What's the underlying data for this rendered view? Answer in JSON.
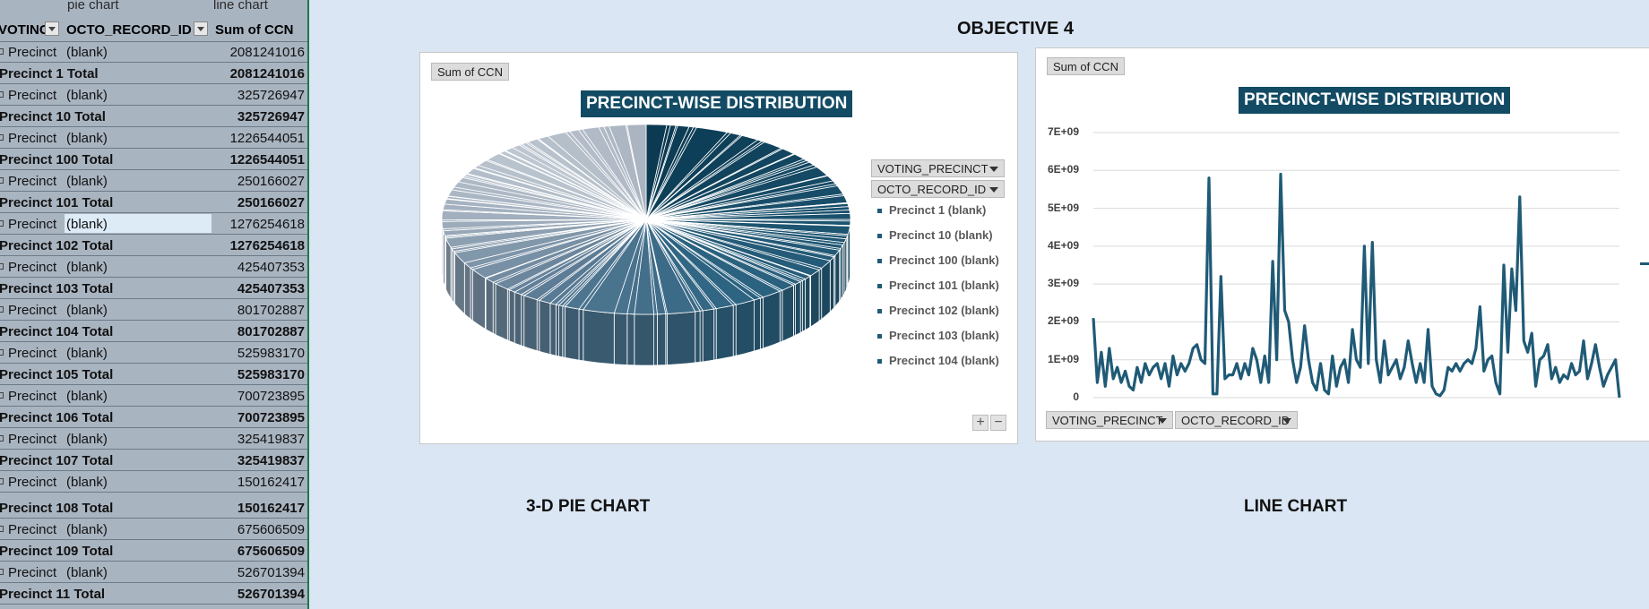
{
  "pivot": {
    "top_labels": [
      "pie chart",
      "line chart"
    ],
    "headers": [
      "VOTING",
      "OCTO_RECORD_ID",
      "Sum of CCN"
    ],
    "rows": [
      {
        "label": "Precinct",
        "sub": "(blank)",
        "value": "2081241016",
        "total": false
      },
      {
        "label": "Precinct 1 Total",
        "sub": "",
        "value": "2081241016",
        "total": true
      },
      {
        "label": "Precinct",
        "sub": "(blank)",
        "value": "325726947",
        "total": false
      },
      {
        "label": "Precinct 10 Total",
        "sub": "",
        "value": "325726947",
        "total": true
      },
      {
        "label": "Precinct",
        "sub": "(blank)",
        "value": "1226544051",
        "total": false
      },
      {
        "label": "Precinct 100 Total",
        "sub": "",
        "value": "1226544051",
        "total": true
      },
      {
        "label": "Precinct",
        "sub": "(blank)",
        "value": "250166027",
        "total": false
      },
      {
        "label": "Precinct 101 Total",
        "sub": "",
        "value": "250166027",
        "total": true
      },
      {
        "label": "Precinct",
        "sub": "(blank)",
        "value": "1276254618",
        "total": false,
        "selected": true
      },
      {
        "label": "Precinct 102 Total",
        "sub": "",
        "value": "1276254618",
        "total": true
      },
      {
        "label": "Precinct",
        "sub": "(blank)",
        "value": "425407353",
        "total": false
      },
      {
        "label": "Precinct 103 Total",
        "sub": "",
        "value": "425407353",
        "total": true
      },
      {
        "label": "Precinct",
        "sub": "(blank)",
        "value": "801702887",
        "total": false
      },
      {
        "label": "Precinct 104 Total",
        "sub": "",
        "value": "801702887",
        "total": true
      },
      {
        "label": "Precinct",
        "sub": "(blank)",
        "value": "525983170",
        "total": false
      },
      {
        "label": "Precinct 105 Total",
        "sub": "",
        "value": "525983170",
        "total": true
      },
      {
        "label": "Precinct",
        "sub": "(blank)",
        "value": "700723895",
        "total": false
      },
      {
        "label": "Precinct 106 Total",
        "sub": "",
        "value": "700723895",
        "total": true
      },
      {
        "label": "Precinct",
        "sub": "(blank)",
        "value": "325419837",
        "total": false
      },
      {
        "label": "Precinct 107 Total",
        "sub": "",
        "value": "325419837",
        "total": true
      },
      {
        "label": "Precinct",
        "sub": "(blank)",
        "value": "150162417",
        "total": false
      },
      {
        "label": "Precinct 108 Total",
        "sub": "",
        "value": "150162417",
        "total": true
      },
      {
        "label": "Precinct",
        "sub": "(blank)",
        "value": "675606509",
        "total": false
      },
      {
        "label": "Precinct 109 Total",
        "sub": "",
        "value": "675606509",
        "total": true
      },
      {
        "label": "Precinct",
        "sub": "(blank)",
        "value": "526701394",
        "total": false
      },
      {
        "label": "Precinct 11 Total",
        "sub": "",
        "value": "526701394",
        "total": true
      }
    ]
  },
  "titles": {
    "objective": "OBJECTIVE 4",
    "pie_caption": "3-D PIE CHART",
    "line_caption": "LINE CHART"
  },
  "pie_panel": {
    "value_button": "Sum of CCN",
    "legend_fields": [
      "VOTING_PRECINCT",
      "OCTO_RECORD_ID"
    ],
    "legend_items": [
      "Precinct 1 (blank)",
      "Precinct 10 (blank)",
      "Precinct 100 (blank)",
      "Precinct 101 (blank)",
      "Precinct 102 (blank)",
      "Precinct 103 (blank)",
      "Precinct 104 (blank)"
    ],
    "zoom_plus": "+",
    "zoom_minus": "−"
  },
  "line_panel": {
    "value_button": "Sum of CCN",
    "axis_fields": [
      "VOTING_PRECINCT",
      "OCTO_RECORD_ID"
    ]
  },
  "chart_data": [
    {
      "type": "pie",
      "title": "PRECINCT-WISE DISTRIBUTION",
      "three_d": true,
      "legend_position": "right",
      "series_colors": [
        "#0b3a52",
        "#1f5a76",
        "#3d6e8a",
        "#6a8aa3",
        "#a9b6c3",
        "#c9d1da"
      ],
      "categories": [
        "Precinct 1 (blank)",
        "Precinct 10 (blank)",
        "Precinct 100 (blank)",
        "Precinct 101 (blank)",
        "Precinct 102 (blank)",
        "Precinct 103 (blank)",
        "Precinct 104 (blank)"
      ],
      "values": [
        2081241016,
        325726947,
        1226544051,
        250166027,
        1276254618,
        425407353,
        801702887
      ]
    },
    {
      "type": "line",
      "title": "PRECINCT-WISE DISTRIBUTION",
      "color": "#1f5a76",
      "ylim": [
        0,
        7000000000
      ],
      "ytick_labels": [
        "0",
        "1E+09",
        "2E+09",
        "3E+09",
        "4E+09",
        "5E+09",
        "6E+09",
        "7E+09"
      ],
      "grid": true,
      "values": [
        2100000000.0,
        400000000.0,
        1200000000.0,
        300000000.0,
        1300000000.0,
        500000000.0,
        800000000.0,
        400000000.0,
        700000000.0,
        300000000.0,
        200000000.0,
        800000000.0,
        400000000.0,
        900000000.0,
        600000000.0,
        800000000.0,
        900000000.0,
        500000000.0,
        900000000.0,
        300000000.0,
        1100000000.0,
        600000000.0,
        900000000.0,
        700000000.0,
        900000000.0,
        1300000000.0,
        1400000000.0,
        1000000000.0,
        900000000.0,
        5800000000.0,
        100000000.0,
        100000000.0,
        3200000000.0,
        500000000.0,
        600000000.0,
        600000000.0,
        900000000.0,
        500000000.0,
        900000000.0,
        600000000.0,
        1300000000.0,
        1000000000.0,
        400000000.0,
        1100000000.0,
        400000000.0,
        3600000000.0,
        1000000000.0,
        5900000000.0,
        2300000000.0,
        2000000000.0,
        1000000000.0,
        400000000.0,
        800000000.0,
        1900000000.0,
        1000000000.0,
        400000000.0,
        200000000.0,
        900000000.0,
        200000000.0,
        100000000.0,
        1100000000.0,
        300000000.0,
        800000000.0,
        1000000000.0,
        400000000.0,
        1800000000.0,
        1000000000.0,
        800000000.0,
        4000000000.0,
        900000000.0,
        4100000000.0,
        1000000000.0,
        400000000.0,
        1500000000.0,
        600000000.0,
        800000000.0,
        1000000000.0,
        500000000.0,
        800000000.0,
        1500000000.0,
        900000000.0,
        400000000.0,
        900000000.0,
        400000000.0,
        1800000000.0,
        300000000.0,
        100000000.0,
        50000000.0,
        200000000.0,
        800000000.0,
        700000000.0,
        900000000.0,
        700000000.0,
        900000000.0,
        1000000000.0,
        900000000.0,
        1300000000.0,
        2400000000.0,
        700000000.0,
        1000000000.0,
        1100000000.0,
        400000000.0,
        100000000.0,
        3500000000.0,
        1200000000.0,
        3400000000.0,
        2300000000.0,
        5300000000.0,
        1500000000.0,
        1200000000.0,
        1700000000.0,
        300000000.0,
        1000000000.0,
        1100000000.0,
        1400000000.0,
        500000000.0,
        800000000.0,
        400000000.0,
        600000000.0,
        500000000.0,
        900000000.0,
        600000000.0,
        700000000.0,
        1500000000.0,
        500000000.0,
        900000000.0,
        1400000000.0,
        800000000.0,
        300000000.0,
        600000000.0,
        800000000.0,
        1000000000.0,
        0.0
      ]
    }
  ]
}
